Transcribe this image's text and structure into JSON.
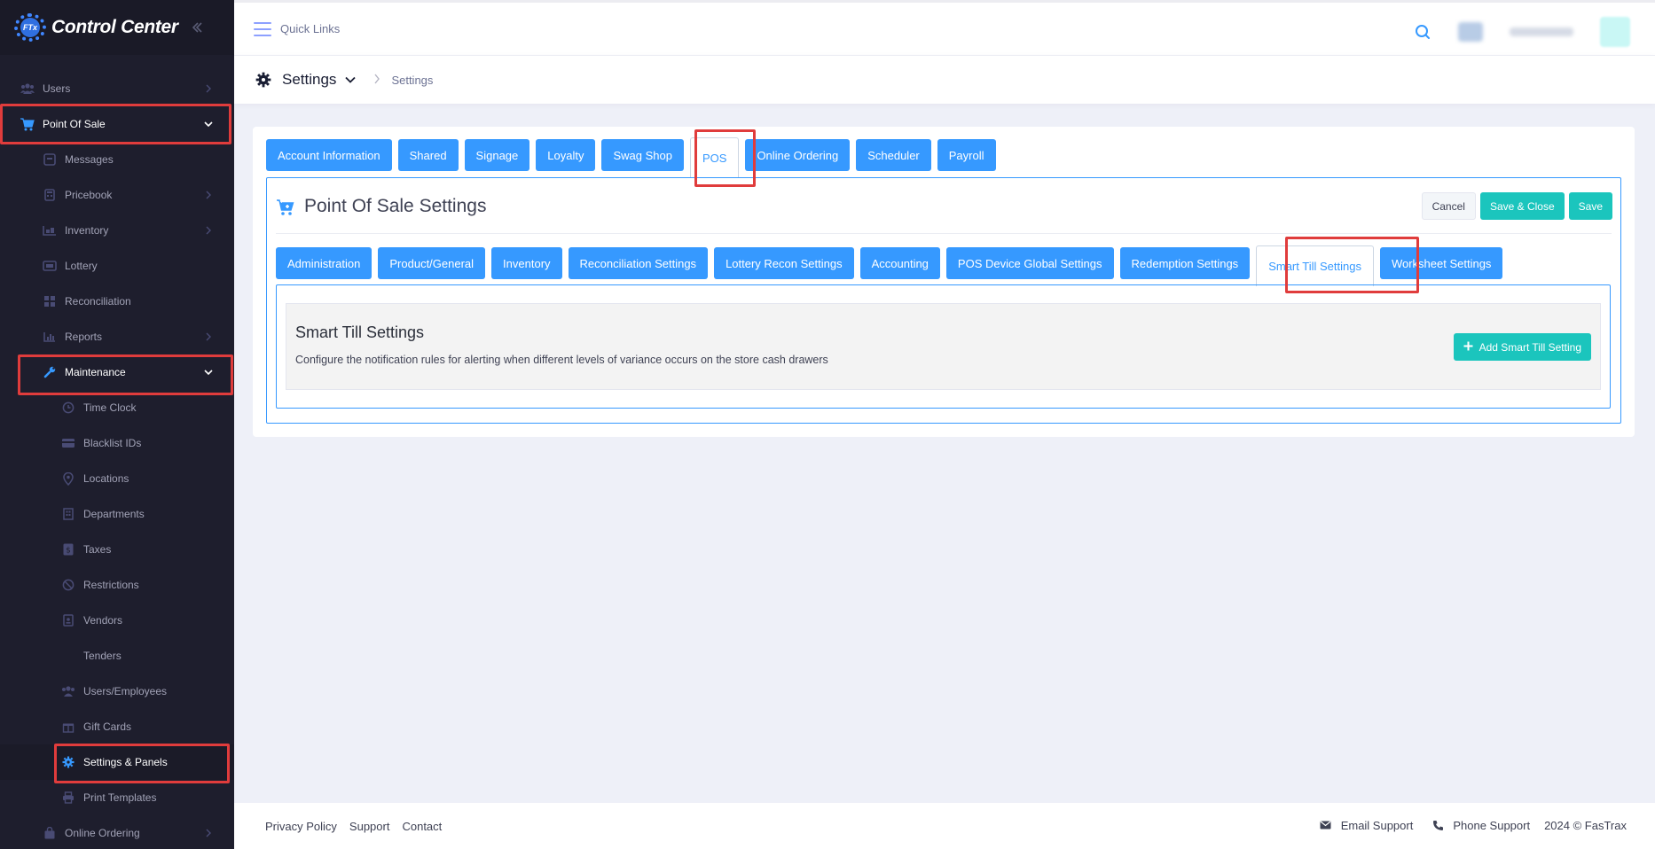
{
  "app": {
    "title": "Control Center",
    "logo_text": "FTx"
  },
  "sidebar": {
    "items": [
      {
        "label": "Users"
      },
      {
        "label": "Point Of Sale"
      },
      {
        "label": "Messages"
      },
      {
        "label": "Pricebook"
      },
      {
        "label": "Inventory"
      },
      {
        "label": "Lottery"
      },
      {
        "label": "Reconciliation"
      },
      {
        "label": "Reports"
      },
      {
        "label": "Maintenance"
      },
      {
        "label": "Time Clock"
      },
      {
        "label": "Blacklist IDs"
      },
      {
        "label": "Locations"
      },
      {
        "label": "Departments"
      },
      {
        "label": "Taxes"
      },
      {
        "label": "Restrictions"
      },
      {
        "label": "Vendors"
      },
      {
        "label": "Tenders"
      },
      {
        "label": "Users/Employees"
      },
      {
        "label": "Gift Cards"
      },
      {
        "label": "Settings & Panels"
      },
      {
        "label": "Print Templates"
      },
      {
        "label": "Online Ordering"
      }
    ]
  },
  "header": {
    "quick_links": "Quick Links"
  },
  "subheader": {
    "title": "Settings",
    "breadcrumb": "Settings"
  },
  "main_tabs": [
    "Account Information",
    "Shared",
    "Signage",
    "Loyalty",
    "Swag Shop",
    "POS",
    "Online Ordering",
    "Scheduler",
    "Payroll"
  ],
  "pos_settings": {
    "title": "Point Of Sale Settings",
    "cancel": "Cancel",
    "save_close": "Save & Close",
    "save": "Save",
    "sub_tabs": [
      "Administration",
      "Product/General",
      "Inventory",
      "Reconciliation Settings",
      "Lottery Recon Settings",
      "Accounting",
      "POS Device Global Settings",
      "Redemption Settings",
      "Smart Till Settings",
      "Worksheet Settings"
    ]
  },
  "smart_till": {
    "title": "Smart Till Settings",
    "description": "Configure the notification rules for alerting when different levels of variance occurs on the store cash drawers",
    "add_button": "Add Smart Till Setting"
  },
  "footer": {
    "links": [
      "Privacy Policy",
      "Support",
      "Contact"
    ],
    "email_support": "Email Support",
    "phone_support": "Phone Support",
    "copyright": "2024 © FasTrax"
  },
  "colors": {
    "primary": "#3699ff",
    "teal": "#1bc5bd",
    "sidebar": "#1e1e2d",
    "highlight": "#e03c3c"
  }
}
